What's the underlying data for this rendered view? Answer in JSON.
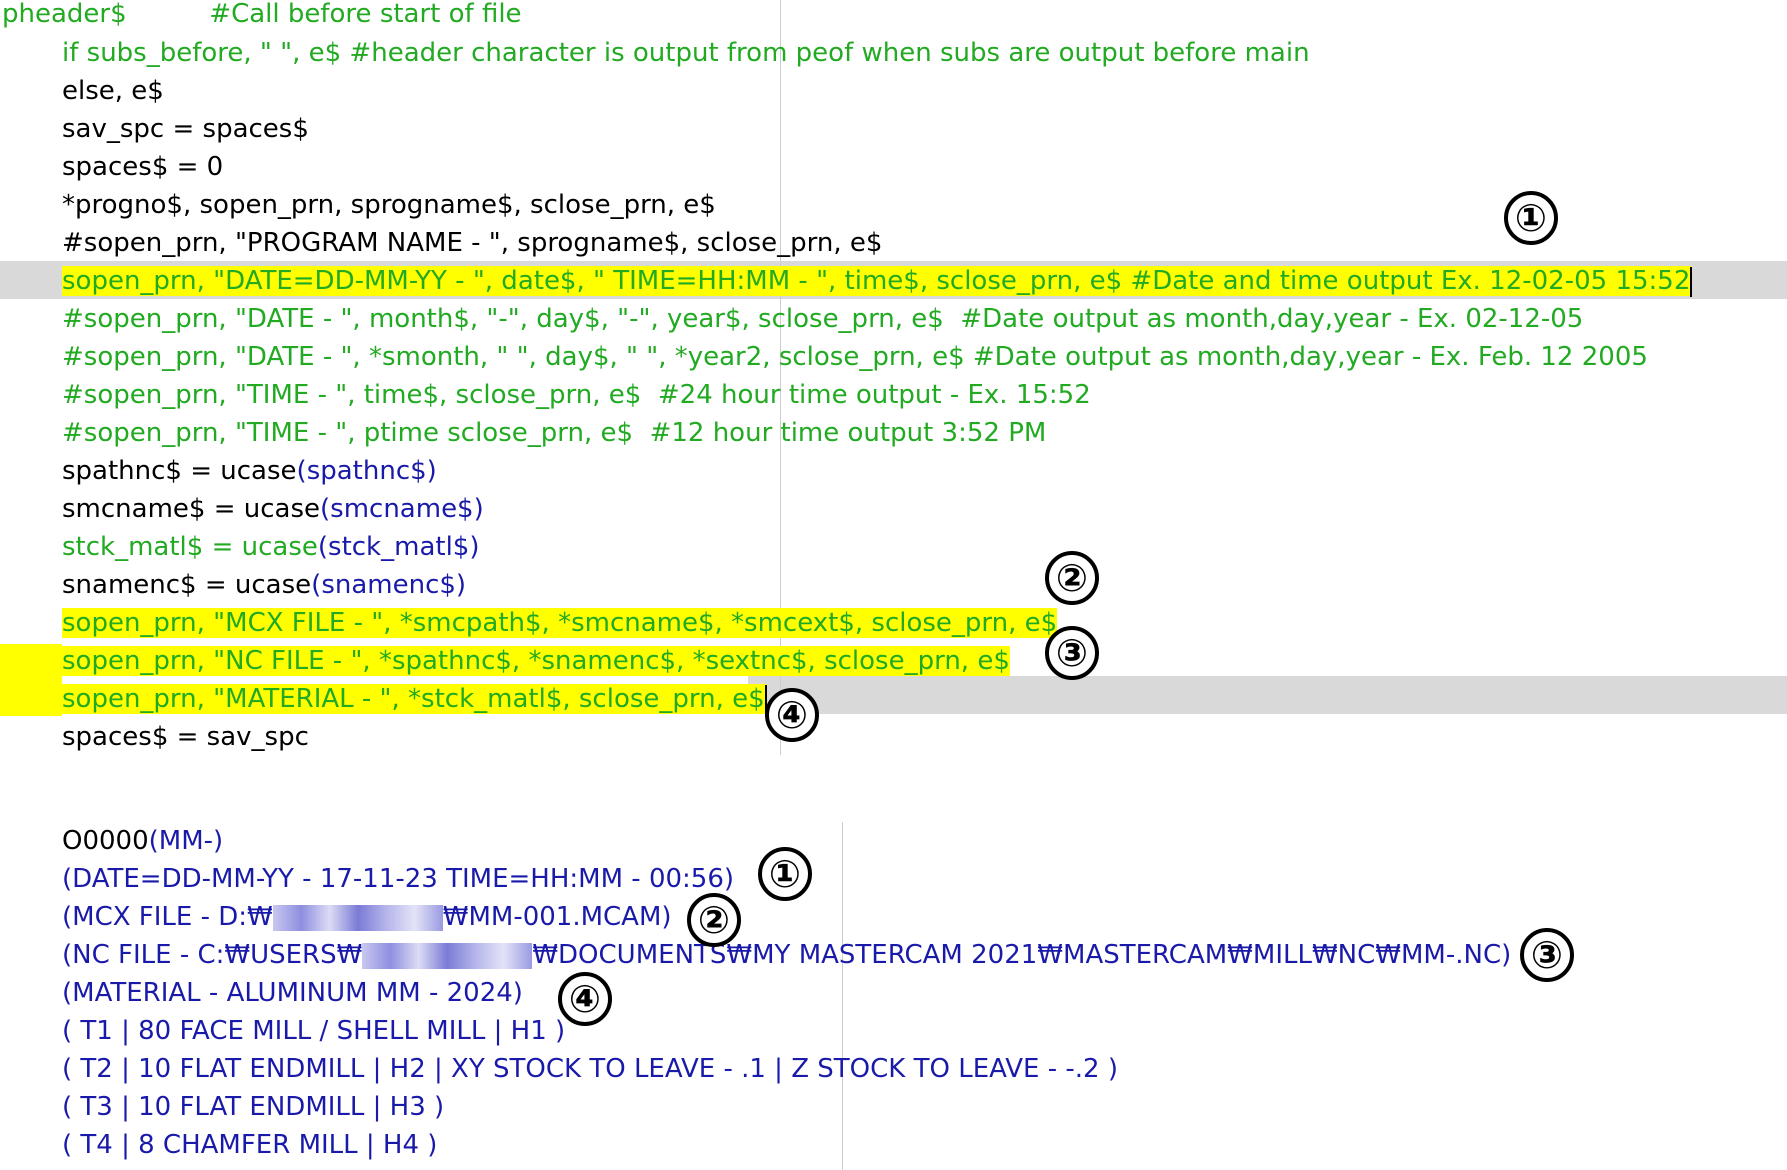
{
  "code_lines": [
    {
      "segments": [
        {
          "t": "pheader$          #Call before start of file",
          "c": "g"
        }
      ]
    },
    {
      "segments": [
        {
          "t": "if subs_before, \" \", e$ #header character is output from peof when subs are output before main",
          "c": "g"
        }
      ]
    },
    {
      "segments": [
        {
          "t": "else, e$",
          "c": "k"
        }
      ]
    },
    {
      "segments": [
        {
          "t": "sav_spc = spaces$",
          "c": "k"
        }
      ]
    },
    {
      "segments": [
        {
          "t": "spaces$ = 0",
          "c": "k"
        }
      ]
    },
    {
      "segments": [
        {
          "t": "*progno$, sopen_prn, sprogname$, sclose_prn, e$",
          "c": "k"
        }
      ]
    },
    {
      "segments": [
        {
          "t": "#sopen_prn, \"PROGRAM NAME - \", sprogname$, sclose_prn, e$",
          "c": "k"
        }
      ]
    },
    {
      "segments": [
        {
          "t": "sopen_prn, \"DATE=DD-MM-YY - \", date$, \" TIME=HH:MM - \", time$, sclose_prn, e$ #Date and time output Ex. 12-02-05 15:52",
          "c": "g"
        }
      ]
    },
    {
      "segments": [
        {
          "t": "#sopen_prn, \"DATE - \", month$, \"-\", day$, \"-\", year$, sclose_prn, e$  #Date output as month,day,year - Ex. 02-12-05",
          "c": "g"
        }
      ]
    },
    {
      "segments": [
        {
          "t": "#sopen_prn, \"DATE - \", *smonth, \" \", day$, \" \", *year2, sclose_prn, e$ #Date output as month,day,year - Ex. Feb. 12 2005",
          "c": "g"
        }
      ]
    },
    {
      "segments": [
        {
          "t": "#sopen_prn, \"TIME - \", time$, sclose_prn, e$  #24 hour time output - Ex. 15:52",
          "c": "g"
        }
      ]
    },
    {
      "segments": [
        {
          "t": "#sopen_prn, \"TIME - \", ptime sclose_prn, e$  #12 hour time output 3:52 PM",
          "c": "g"
        }
      ]
    },
    {
      "segments": [
        {
          "t": "spathnc$ = ucase",
          "c": "k"
        },
        {
          "t": "(spathnc$)",
          "c": "b"
        }
      ]
    },
    {
      "segments": [
        {
          "t": "smcname$ = ucase",
          "c": "k"
        },
        {
          "t": "(smcname$)",
          "c": "b"
        }
      ]
    },
    {
      "segments": [
        {
          "t": "stck_matl$ = ucase",
          "c": "g"
        },
        {
          "t": "(stck_matl$)",
          "c": "b"
        }
      ]
    },
    {
      "segments": [
        {
          "t": "snamenc$ = ucase",
          "c": "k"
        },
        {
          "t": "(snamenc$)",
          "c": "b"
        }
      ]
    },
    {
      "segments": [
        {
          "t": "sopen_prn, \"MCX FILE - \", *smcpath$, *smcname$, *smcext$, sclose_prn, e$",
          "c": "g"
        }
      ]
    },
    {
      "segments": [
        {
          "t": "sopen_prn, \"NC FILE - \", *spathnc$, *snamenc$, *sextnc$, sclose_prn, e$",
          "c": "g"
        }
      ]
    },
    {
      "segments": [
        {
          "t": "sopen_prn, \"MATERIAL - \", *stck_matl$, sclose_prn, e$",
          "c": "g"
        }
      ]
    },
    {
      "segments": [
        {
          "t": "spaces$ = sav_spc",
          "c": "k"
        }
      ]
    }
  ],
  "output_lines": [
    {
      "segments": [
        {
          "t": "O0000",
          "c": "k"
        },
        {
          "t": "(MM-)",
          "c": "b"
        }
      ]
    },
    {
      "segments": [
        {
          "t": "(DATE=DD-MM-YY - 17-11-23 TIME=HH:MM - 00:56)",
          "c": "b"
        }
      ]
    },
    {
      "segments": [
        {
          "t": "(MCX FILE - D:₩",
          "c": "b"
        },
        {
          "blur": 170
        },
        {
          "t": "₩MM-001.MCAM)",
          "c": "b"
        }
      ]
    },
    {
      "segments": [
        {
          "t": "(NC FILE - C:₩USERS₩",
          "c": "b"
        },
        {
          "blur": 170
        },
        {
          "t": "₩DOCUMENTS₩MY MASTERCAM 2021₩MASTERCAM₩MILL₩NC₩MM-.NC)",
          "c": "b"
        }
      ]
    },
    {
      "segments": [
        {
          "t": "(MATERIAL - ALUMINUM MM - 2024)",
          "c": "b"
        }
      ]
    },
    {
      "segments": [
        {
          "t": "( T1 | 80 FACE MILL / SHELL MILL | H1 )",
          "c": "b"
        }
      ]
    },
    {
      "segments": [
        {
          "t": "( T2 | 10 FLAT ENDMILL | H2 | XY STOCK TO LEAVE - .1 | Z STOCK TO LEAVE - -.2 )",
          "c": "b"
        }
      ]
    },
    {
      "segments": [
        {
          "t": "( T3 | 10 FLAT ENDMILL | H3 )",
          "c": "b"
        }
      ]
    },
    {
      "segments": [
        {
          "t": "( T4 | 8 CHAMFER MILL | H4 )",
          "c": "b"
        }
      ]
    }
  ],
  "badges": {
    "one": "①",
    "two": "②",
    "three": "③",
    "four": "④"
  },
  "colors": {
    "comment_green": "#22aa22",
    "text_black": "#000000",
    "paren_blue": "#1a1aaa",
    "highlight": "#ffff00",
    "band_gray": "#d9d9d9"
  }
}
